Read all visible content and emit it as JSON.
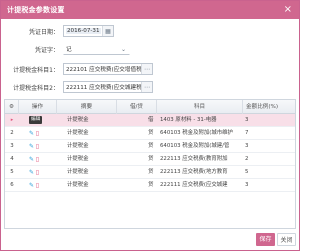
{
  "dialog": {
    "title": "计提税金参数设置",
    "close_glyph": "×"
  },
  "form": {
    "voucher_date": {
      "label": "凭证日期：",
      "value": "2016-07-31",
      "icon": "calendar-icon"
    },
    "voucher_word": {
      "label": "凭证字：",
      "value": "记",
      "icon": "chevron-down-icon"
    },
    "tax_account_1": {
      "label": "计提税金科目1：",
      "value": "222101 应交税费(应交增值税",
      "icon": "ellipsis-icon"
    },
    "tax_account_2": {
      "label": "计提税金科目2：",
      "value": "222111 应交税费(应交城建税",
      "icon": "ellipsis-icon"
    }
  },
  "grid": {
    "columns": [
      "",
      "操作",
      "摘要",
      "借/贷",
      "科目",
      "金额比例(%)"
    ],
    "edit_tooltip": "编辑",
    "rows": [
      {
        "no": "1",
        "summary": "计提税金",
        "dc": "借",
        "account": "1403 原材料 - 31-电器",
        "rate": "3"
      },
      {
        "no": "2",
        "summary": "计提税金",
        "dc": "贷",
        "account": "640103 税金及附加(城市维护",
        "rate": "7"
      },
      {
        "no": "3",
        "summary": "计提税金",
        "dc": "贷",
        "account": "640103 税金及附加(城建/管",
        "rate": "3"
      },
      {
        "no": "4",
        "summary": "计提税金",
        "dc": "贷",
        "account": "222113 应交税费(教育附加",
        "rate": "2"
      },
      {
        "no": "5",
        "summary": "计提税金",
        "dc": "贷",
        "account": "222113 应交税费(地方教育",
        "rate": "5"
      },
      {
        "no": "6",
        "summary": "计提税金",
        "dc": "贷",
        "account": "222111 应交税费(应交城建",
        "rate": "3"
      }
    ]
  },
  "footer": {
    "save_label": "保存",
    "close_label": "关闭"
  },
  "colors": {
    "accent": "#d0678f",
    "selected_row": "#f8dfe8",
    "edit_icon": "#2e9fd8",
    "delete_icon": "#e0557d"
  }
}
